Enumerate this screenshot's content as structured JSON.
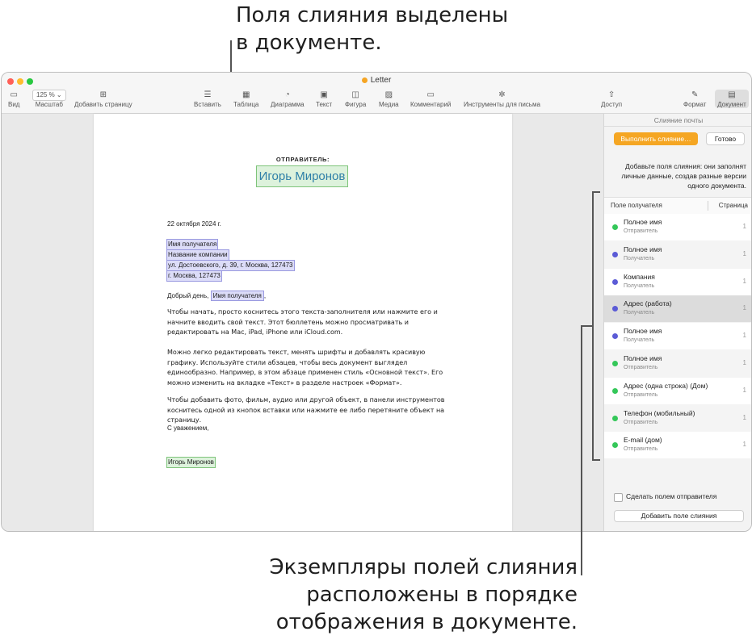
{
  "callouts": {
    "top": [
      "Поля слияния выделены",
      "в документе."
    ],
    "bottom": [
      "Экземпляры полей слияния",
      "расположены в порядке",
      "отображения в документе."
    ]
  },
  "window": {
    "title": "Letter",
    "traffic_colors": [
      "#ff5f57",
      "#febc2e",
      "#28c840"
    ]
  },
  "toolbar": {
    "view": "Вид",
    "zoom_value": "125 %",
    "zoom_label": "Масштаб",
    "add_page": "Добавить страницу",
    "insert": "Вставить",
    "table": "Таблица",
    "chart": "Диаграмма",
    "text": "Текст",
    "shape": "Фигура",
    "media": "Медиа",
    "comment": "Комментарий",
    "mail_tools": "Инструменты для письма",
    "share": "Доступ",
    "format": "Формат",
    "document": "Документ"
  },
  "letter": {
    "sender_label": "ОТПРАВИТЕЛЬ:",
    "sender_name": "Игорь Миронов",
    "date": "22 октября 2024 г.",
    "recipient_name": "Имя получателя",
    "company": "Название компании",
    "address": "ул. Достоевского, д. 39, г. Москва, 127473",
    "city": "г. Москва, 127473",
    "greeting_prefix": "Добрый день,",
    "greeting_field": "Имя получателя",
    "greeting_suffix": ",",
    "para1": "Чтобы начать, просто коснитесь этого текста-заполнителя или нажмите его и начните вводить свой текст. Этот бюллетень можно просматривать и редактировать на Mac, iPad, iPhone или iCloud.com.",
    "para2": "Можно легко редактировать текст, менять шрифты и добавлять красивую графику. Используйте стили абзацев, чтобы весь документ выглядел единообразно. Например, в этом абзаце применен стиль «Основной текст». Его можно изменить на вкладке «Текст» в разделе настроек «Формат».",
    "para3": "Чтобы добавить фото, фильм, аудио или другой объект, в панели инструментов коснитесь одной из кнопок вставки или нажмите ее либо перетяните объект на страницу.",
    "closing": "С уважением,",
    "signature": "Игорь Миронов"
  },
  "sidebar": {
    "title": "Слияние почты",
    "run_button": "Выполнить слияние…",
    "done_button": "Готово",
    "description": "Добавьте поля слияния: они заполнят личные данные, создав разные версии одного документа.",
    "col_field": "Поле получателя",
    "col_page": "Страница",
    "colors": {
      "sender": "#34c759",
      "recipient": "#5b5bd6"
    },
    "rows": [
      {
        "name": "Полное имя",
        "type": "Отправитель",
        "page": "1",
        "role": "sender"
      },
      {
        "name": "Полное имя",
        "type": "Получатель",
        "page": "1",
        "role": "recipient"
      },
      {
        "name": "Компания",
        "type": "Получатель",
        "page": "1",
        "role": "recipient"
      },
      {
        "name": "Адрес (работа)",
        "type": "Получатель",
        "page": "1",
        "role": "recipient"
      },
      {
        "name": "Полное имя",
        "type": "Получатель",
        "page": "1",
        "role": "recipient"
      },
      {
        "name": "Полное имя",
        "type": "Отправитель",
        "page": "1",
        "role": "sender"
      },
      {
        "name": "Адрес (одна строка) (Дом)",
        "type": "Отправитель",
        "page": "1",
        "role": "sender"
      },
      {
        "name": "Телефон (мобильный)",
        "type": "Отправитель",
        "page": "1",
        "role": "sender"
      },
      {
        "name": "E-mail (дом)",
        "type": "Отправитель",
        "page": "1",
        "role": "sender"
      }
    ],
    "selected_row": 3,
    "checkbox_label": "Сделать полем отправителя",
    "add_field_button": "Добавить поле слияния"
  }
}
